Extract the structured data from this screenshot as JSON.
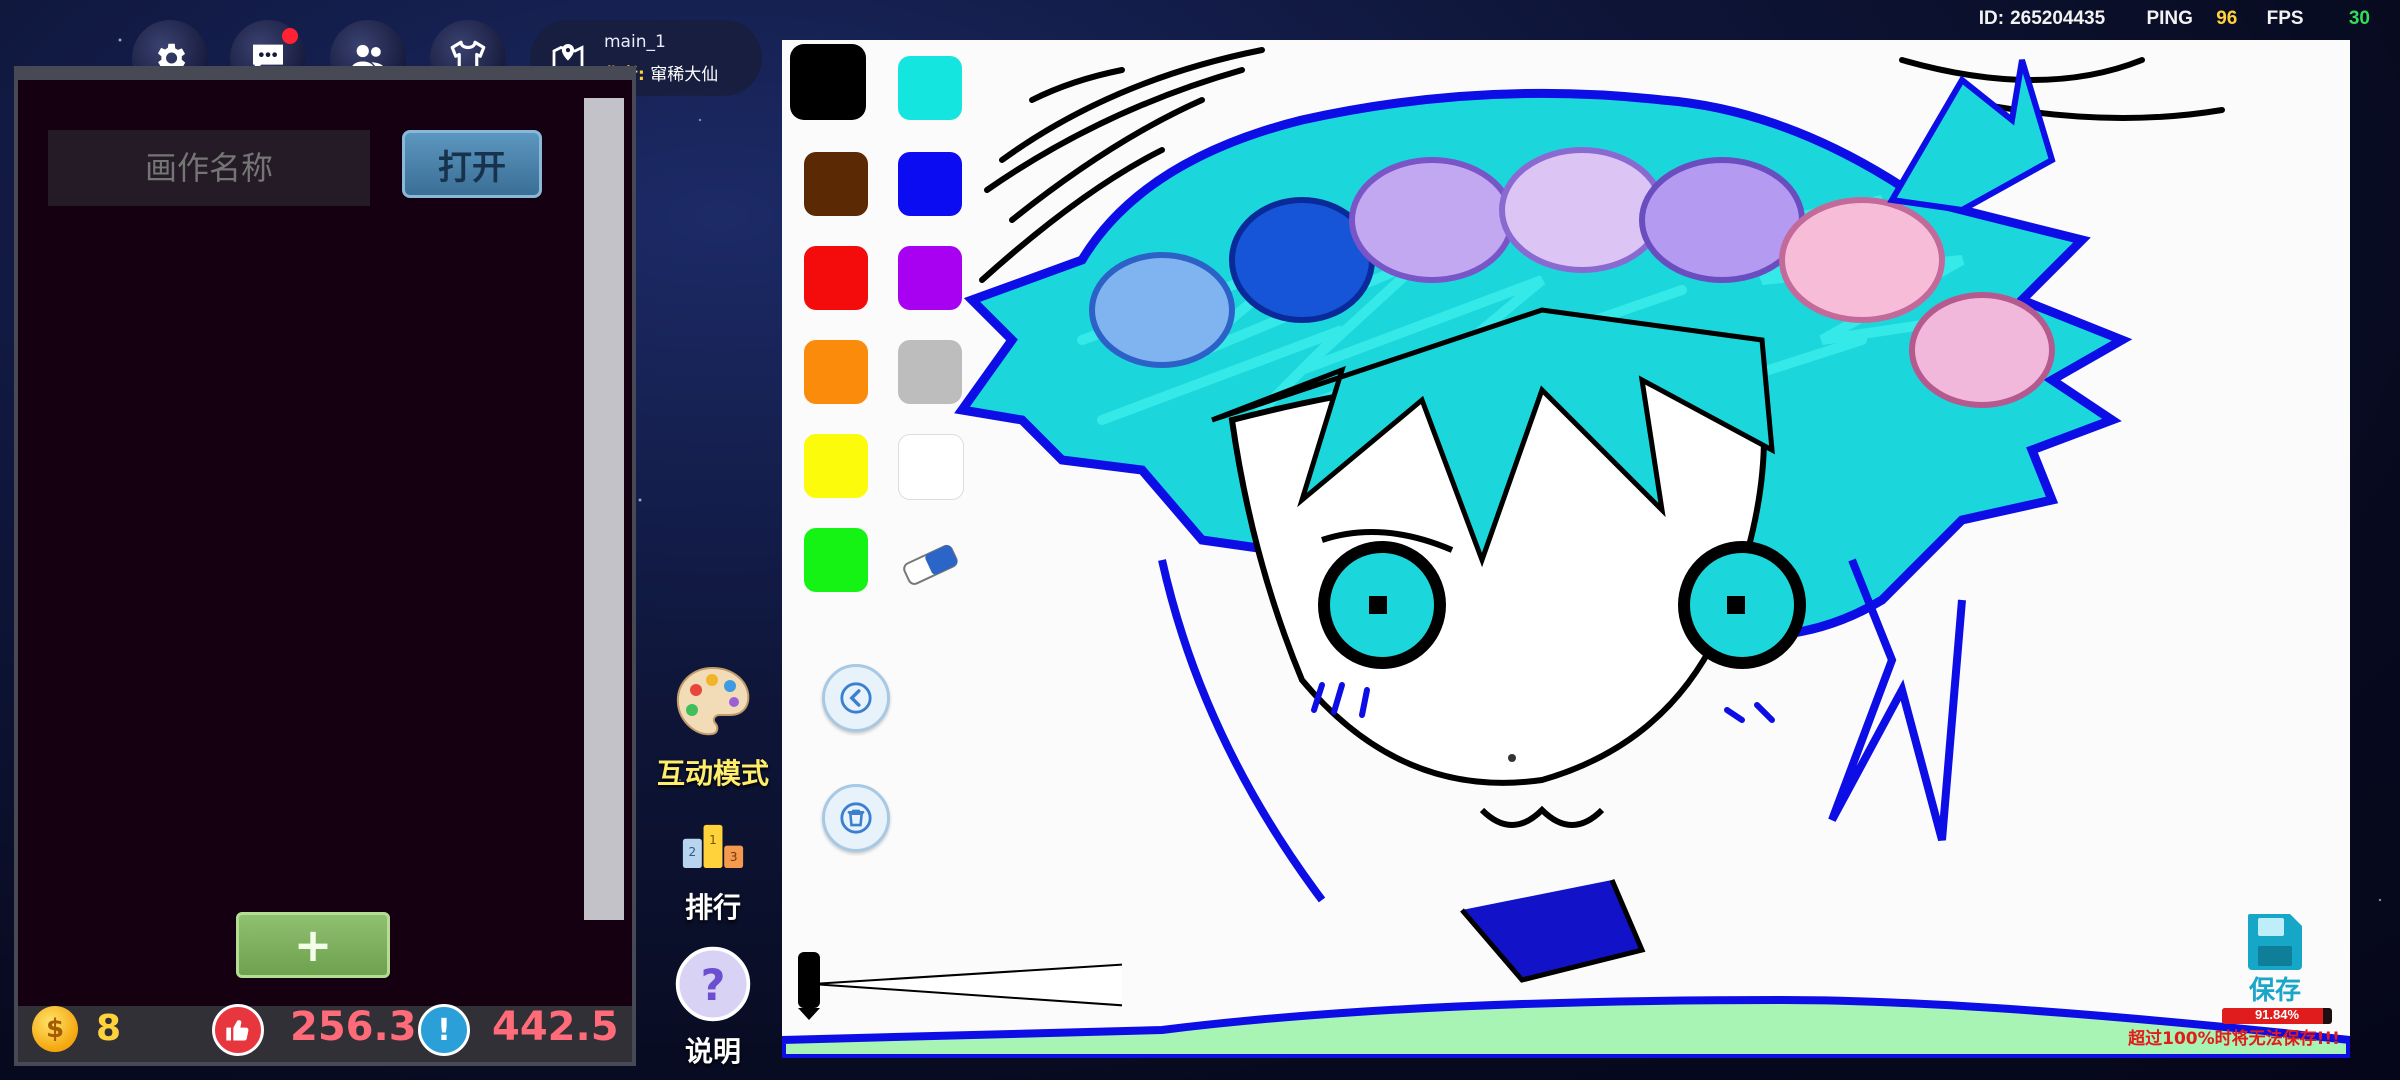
{
  "topbar": {
    "icons": [
      "gear-icon",
      "chat-icon",
      "friends-icon",
      "wardrobe-icon",
      "map-pin-icon"
    ],
    "room_name": "main_1",
    "author_label": "作者:",
    "author_name": "窜稀大仙"
  },
  "stats": {
    "id_label": "ID:",
    "id_value": "265204435",
    "ping_label": "PING",
    "ping_value": "96",
    "fps_label": "FPS",
    "fps_value": "30"
  },
  "left_panel": {
    "name_placeholder": "画作名称",
    "open_label": "打开",
    "add_label": "+"
  },
  "currency": {
    "coins": "8",
    "likes": "256.3",
    "alerts": "442.5"
  },
  "side_actions": {
    "interactive_label": "互动模式",
    "ranking_label": "排行",
    "help_label": "说明"
  },
  "palette": {
    "colors": [
      "#000000",
      "#14e5df",
      "#5b2a05",
      "#0c0cf2",
      "#f40c0c",
      "#a800f0",
      "#fb8b0b",
      "#bdbdbd",
      "#fbfb0b",
      "#ffffff",
      "#14f314"
    ],
    "selected": "#000000",
    "tools": [
      "eraser-icon",
      "undo-icon",
      "trash-icon"
    ]
  },
  "save": {
    "label": "保存",
    "progress_text": "91.84%",
    "progress_value": 91.84,
    "warning": "超过100%时将无法保存!!!"
  }
}
